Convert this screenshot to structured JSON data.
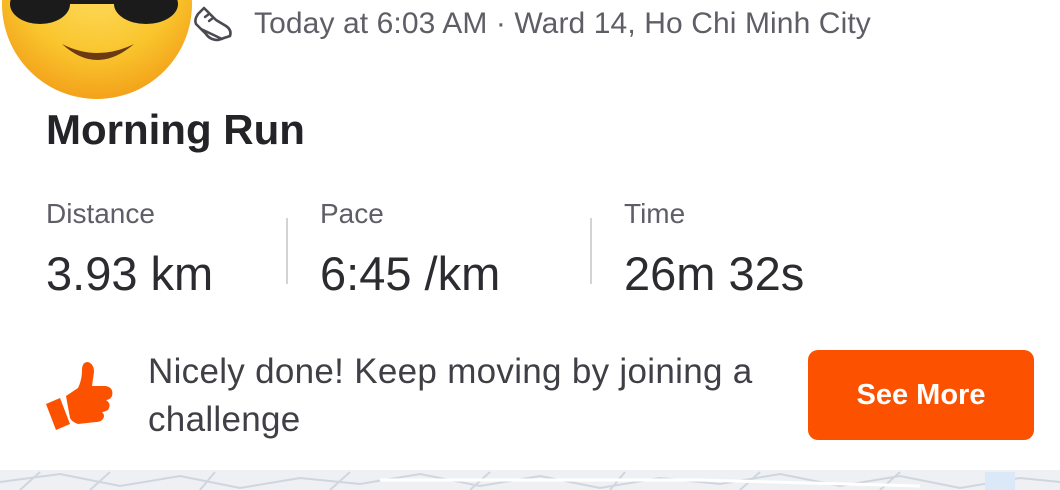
{
  "activity": {
    "meta_text": "Today at 6:03 AM · Ward 14, Ho Chi Minh City",
    "title": "Morning Run",
    "sport_icon": "running-shoe-icon",
    "avatar_icon": "sunglasses-emoji-avatar"
  },
  "stats": [
    {
      "label": "Distance",
      "value": "3.93 km"
    },
    {
      "label": "Pace",
      "value": "6:45 /km"
    },
    {
      "label": "Time",
      "value": "26m 32s"
    }
  ],
  "promo": {
    "icon": "thumbs-up-icon",
    "text": "Nicely done! Keep moving by joining a challenge",
    "button_label": "See More"
  },
  "colors": {
    "accent": "#fc5200",
    "title_text": "#242428",
    "secondary_text": "#5e5e66",
    "emoji_yellow": "#f7b92b",
    "divider": "#d3d3d8"
  }
}
